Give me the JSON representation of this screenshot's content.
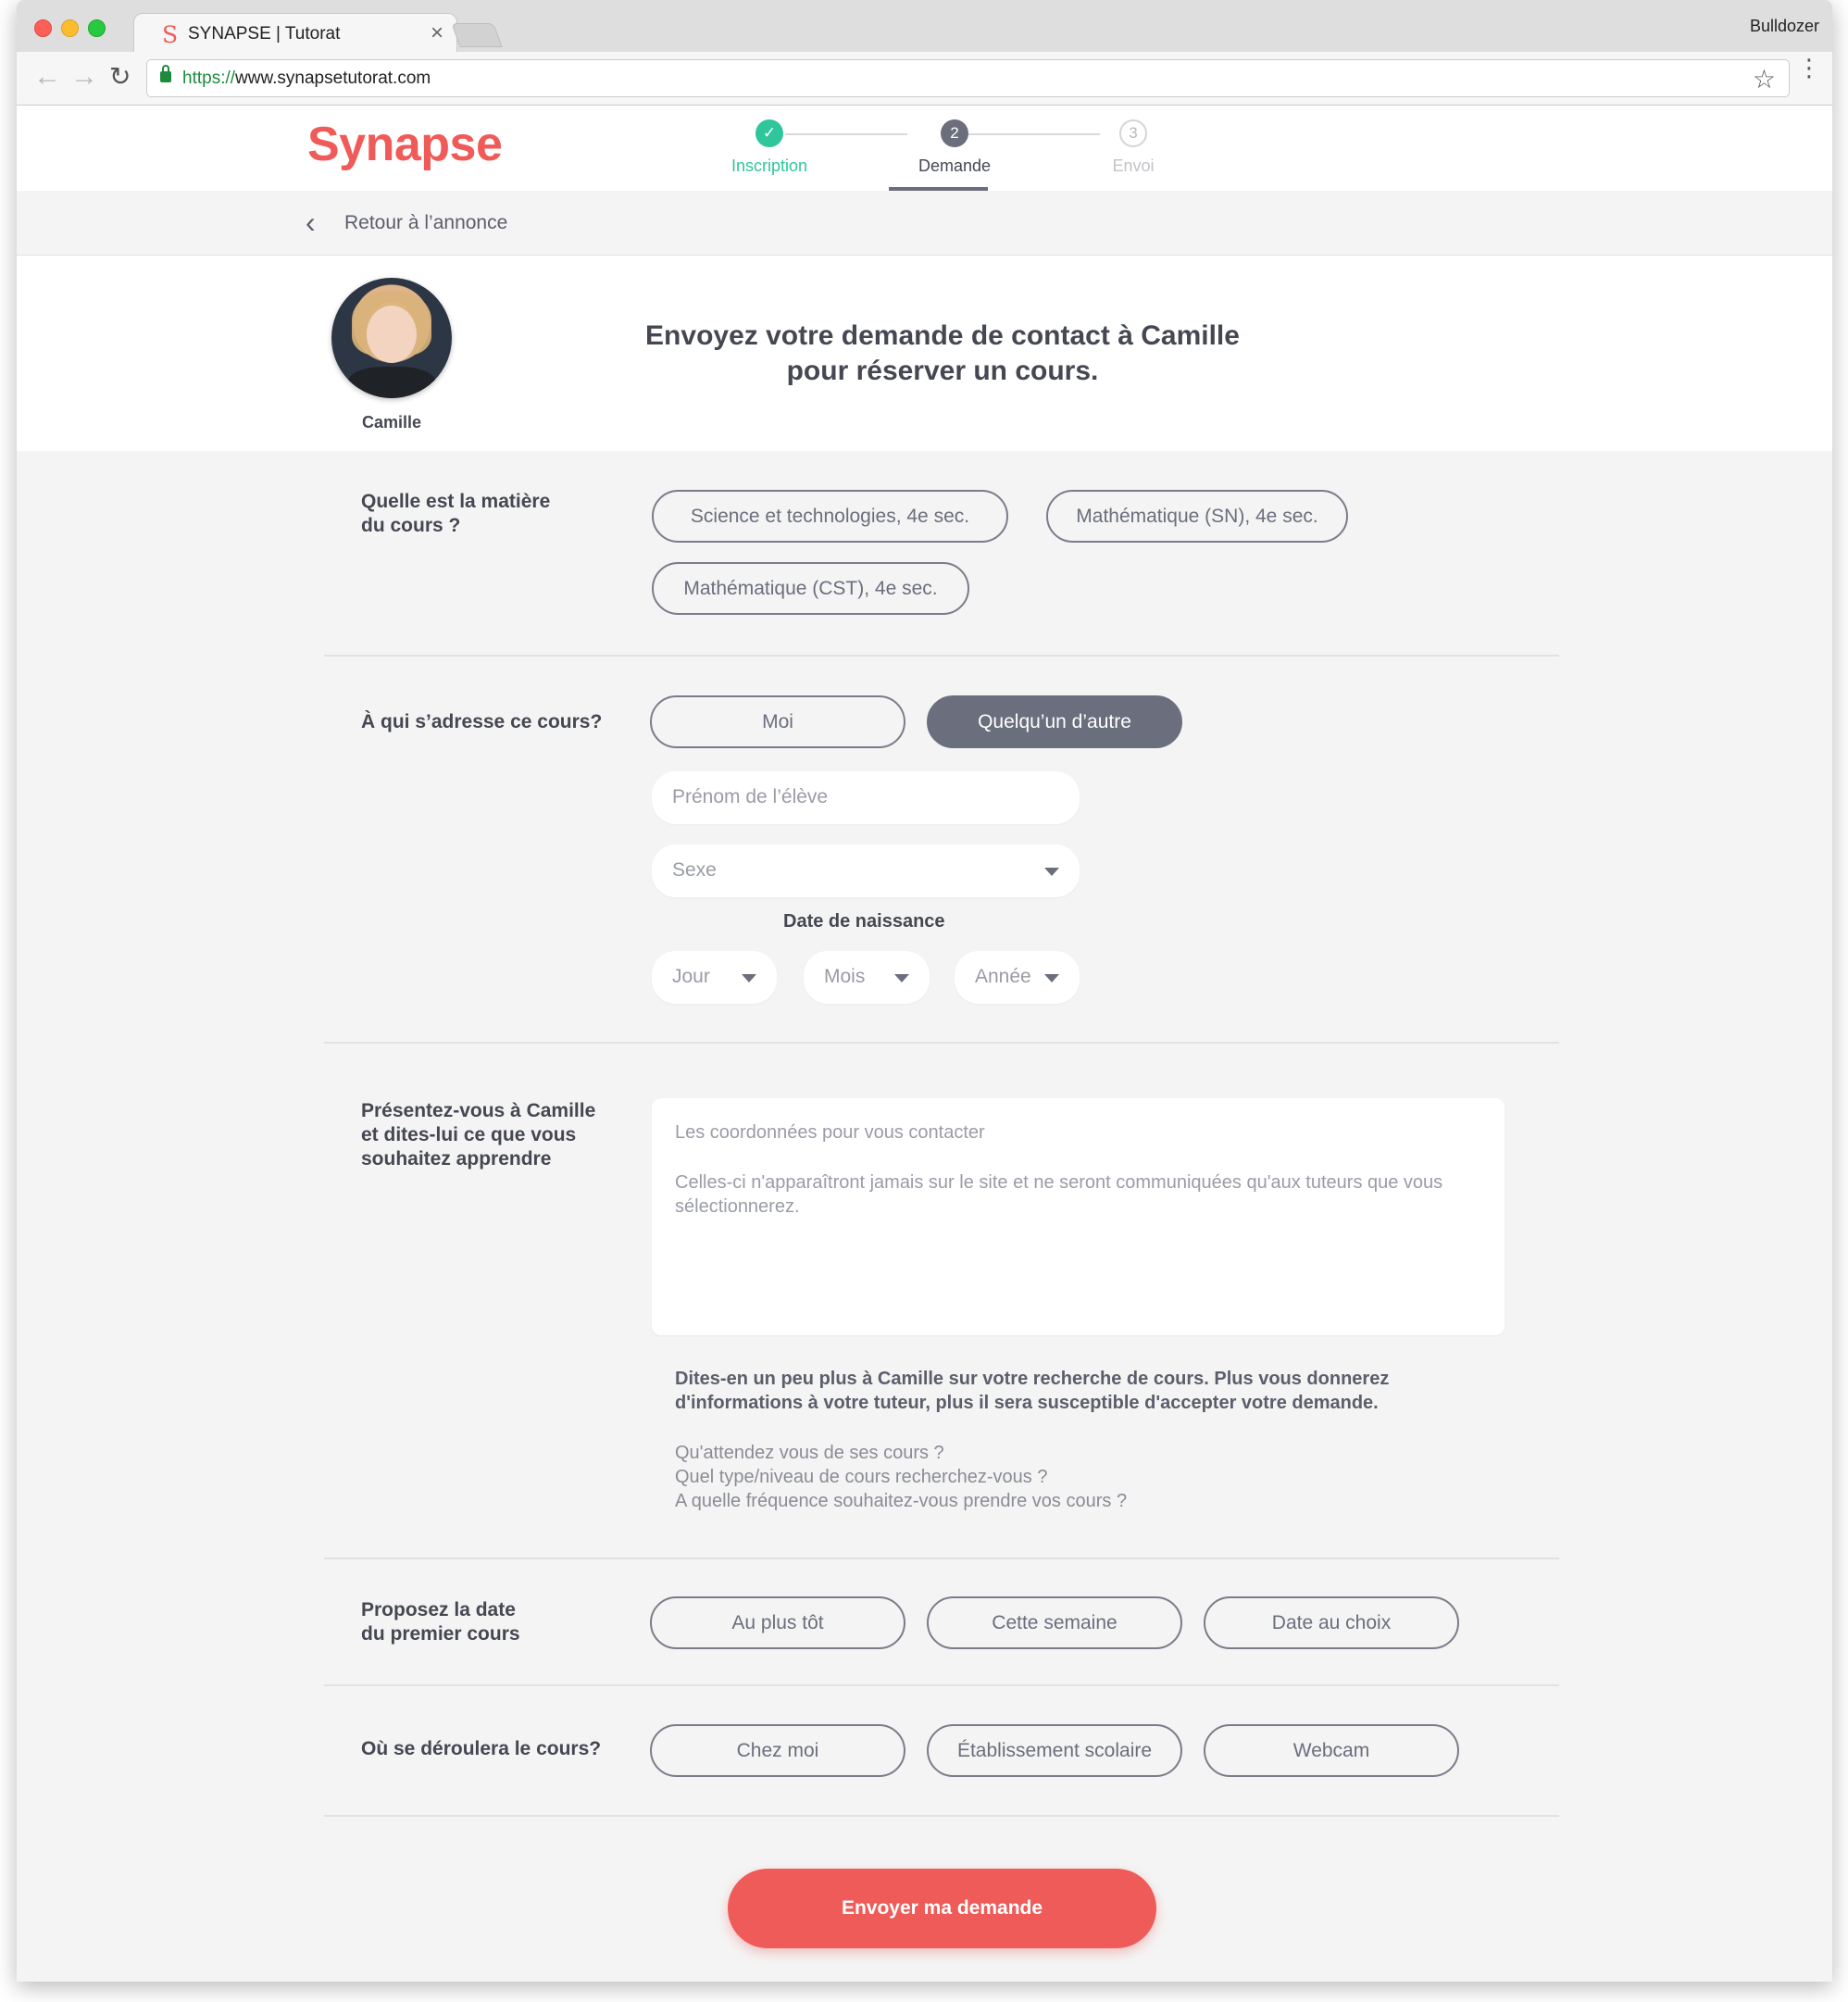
{
  "browser": {
    "tab_title": "SYNAPSE | Tutorat",
    "tab_close": "×",
    "profile_name": "Bulldozer",
    "url_scheme": "https://",
    "url_rest": "www.synapsetutorat.com"
  },
  "header": {
    "logo": "Synapse",
    "steps": [
      {
        "number": "✓",
        "label": "Inscription",
        "state": "done"
      },
      {
        "number": "2",
        "label": "Demande",
        "state": "active"
      },
      {
        "number": "3",
        "label": "Envoi",
        "state": "pending"
      }
    ]
  },
  "back": {
    "label": "Retour à l’annonce"
  },
  "tutor": {
    "name": "Camille",
    "title_line1": "Envoyez votre demande de contact à Camille",
    "title_line2": "pour réserver un cours."
  },
  "subject": {
    "question_line1": "Quelle est la matière",
    "question_line2": "du cours ?",
    "options": [
      "Science et technologies, 4e sec.",
      "Mathématique (SN), 4e sec.",
      "Mathématique (CST), 4e sec."
    ]
  },
  "audience": {
    "question": "À qui s’adresse ce cours?",
    "options": [
      "Moi",
      "Quelqu’un d’autre"
    ],
    "selected": "Quelqu’un d’autre",
    "student_name_placeholder": "Prénom de l’élève",
    "sex_placeholder": "Sexe",
    "dob_label": "Date de naissance",
    "dob_day": "Jour",
    "dob_month": "Mois",
    "dob_year": "Année"
  },
  "intro": {
    "question_line1": "Présentez-vous à Camille",
    "question_line2": "et dites-lui ce que vous",
    "question_line3": "souhaitez apprendre",
    "placeholder_line1": "Les coordonnées pour vous contacter",
    "placeholder_line2": "Celles-ci n'apparaîtront jamais sur le site et ne seront communiquées qu'aux tuteurs que vous sélectionnerez.",
    "help_strong": "Dites-en un peu plus à Camille sur votre recherche de cours. Plus vous donnerez d'informations à votre tuteur, plus il sera susceptible d'accepter votre demande.",
    "help_q1": "Qu'attendez vous de ses cours ?",
    "help_q2": "Quel type/niveau de cours recherchez-vous ?",
    "help_q3": "A quelle fréquence souhaitez-vous prendre vos cours ?"
  },
  "first_date": {
    "question_line1": "Proposez la date",
    "question_line2": "du premier cours",
    "options": [
      "Au plus tôt",
      "Cette semaine",
      "Date au choix"
    ]
  },
  "location": {
    "question": "Où se déroulera le cours?",
    "options": [
      "Chez moi",
      "Établissement scolaire",
      "Webcam"
    ]
  },
  "submit_label": "Envoyer ma demande",
  "colors": {
    "brand": "#ef5b58",
    "success": "#2fc69c",
    "selected_pill": "#6b6e7d"
  }
}
